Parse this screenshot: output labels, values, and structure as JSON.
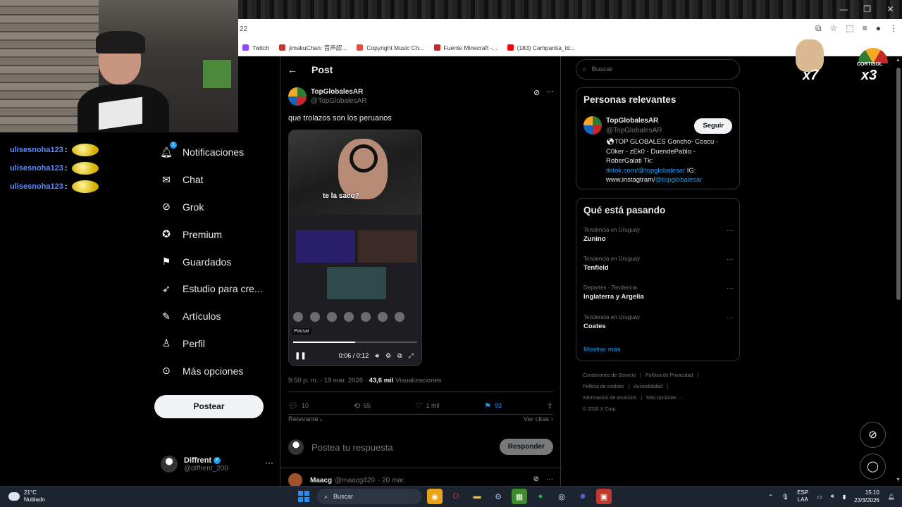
{
  "browser": {
    "address_text": "22",
    "bookmarks": [
      {
        "label": "Twitch",
        "color": "#9146ff"
      },
      {
        "label": "jimakuChan: 音声認...",
        "color": "#c0392b"
      },
      {
        "label": "Copyright Music Ch...",
        "color": "#e74c3c"
      },
      {
        "label": "Fuente Minecraft -...",
        "color": "#c62828"
      },
      {
        "label": "(183) Campanita_Id...",
        "color": "#ff0000"
      }
    ]
  },
  "stream_chat": [
    {
      "user": "ulisesnoha123",
      "colon": ":"
    },
    {
      "user": "ulisesnoha123",
      "colon": ":"
    },
    {
      "user": "ulisesnoha123",
      "colon": ":"
    }
  ],
  "nav": {
    "items": [
      {
        "label": "Notificaciones",
        "icon": "bell-icon",
        "badge": "1"
      },
      {
        "label": "Chat",
        "icon": "mail-icon"
      },
      {
        "label": "Grok",
        "icon": "grok-icon"
      },
      {
        "label": "Premium",
        "icon": "verified-check-icon"
      },
      {
        "label": "Guardados",
        "icon": "bookmark-icon"
      },
      {
        "label": "Estudio para cre...",
        "icon": "rocket-icon"
      },
      {
        "label": "Artículos",
        "icon": "article-icon"
      },
      {
        "label": "Perfil",
        "icon": "person-icon"
      },
      {
        "label": "Más opciones",
        "icon": "more-circle-icon"
      }
    ],
    "post_button": "Postear",
    "account": {
      "name": "Diffrent",
      "handle": "@diffrent_200"
    }
  },
  "main": {
    "header_title": "Post",
    "tweet": {
      "name": "TopGlobalesAR",
      "handle": "@TopGlobalesAR",
      "text": "que trolazos son los peruanos",
      "video": {
        "caption": "te la saco?",
        "tooltip": "Pausar",
        "time": "0:06 / 0:12",
        "progress": 0.5
      },
      "meta_time": "9:50 p. m. · 19 mar. 2026 · ",
      "views_count": "43,6 mil",
      "views_label": " Visualizaciones",
      "replies": "10",
      "retweets": "65",
      "likes": "1 mil",
      "bookmarks": "93"
    },
    "sort_label": "Relevante",
    "quotes_link": "Ver citas",
    "reply_placeholder": "Postea tu respuesta",
    "reply_button": "Responder",
    "next_tweet": {
      "name": "Maacg",
      "handle": "@maacg420",
      "date": "· 20 mar."
    }
  },
  "sidebar": {
    "search_placeholder": "Buscar",
    "relevant": {
      "title": "Personas relevantes",
      "name": "TopGlobalesAR",
      "handle": "@TopGlobalesAR",
      "follow_button": "Seguir",
      "bio_1": "TOP GLOBALES Goncho- Coscu - C0ker - zEk0 - DuendePablo - RoberGalati Tk: ",
      "bio_link_1": "tiktok.com/@topglobalesar",
      "bio_2": " IG: www.instagtram/",
      "bio_link_2": "@topglobalesar"
    },
    "trends": {
      "title": "Qué está pasando",
      "items": [
        {
          "category": "Tendencia en Uruguay",
          "name": "Zunino"
        },
        {
          "category": "Tendencia en Uruguay",
          "name": "Tenfield"
        },
        {
          "category": "Deportes · Tendencia",
          "name": "Inglaterra y Argelia"
        },
        {
          "category": "Tendencia en Uruguay",
          "name": "Coates"
        }
      ],
      "show_more": "Mostrar más"
    },
    "footer_links": [
      "Condiciones de Servicio",
      "|",
      "Política de Privacidad",
      "|",
      "Política de cookies",
      "|",
      "Accesibilidad",
      "|",
      "Información de anuncios",
      "|",
      "Más opciones ···",
      "© 2026 X Corp."
    ]
  },
  "overlay": {
    "cat_multiplier": "x7",
    "cortisol_label": "CORTISOL",
    "cortisol_multiplier": "x3"
  },
  "taskbar": {
    "weather_temp": "21°C",
    "weather_desc": "Nublado",
    "search_label": "Buscar",
    "lang_1": "ESP",
    "lang_2": "LAA",
    "time": "15:10",
    "date": "23/3/2026"
  }
}
